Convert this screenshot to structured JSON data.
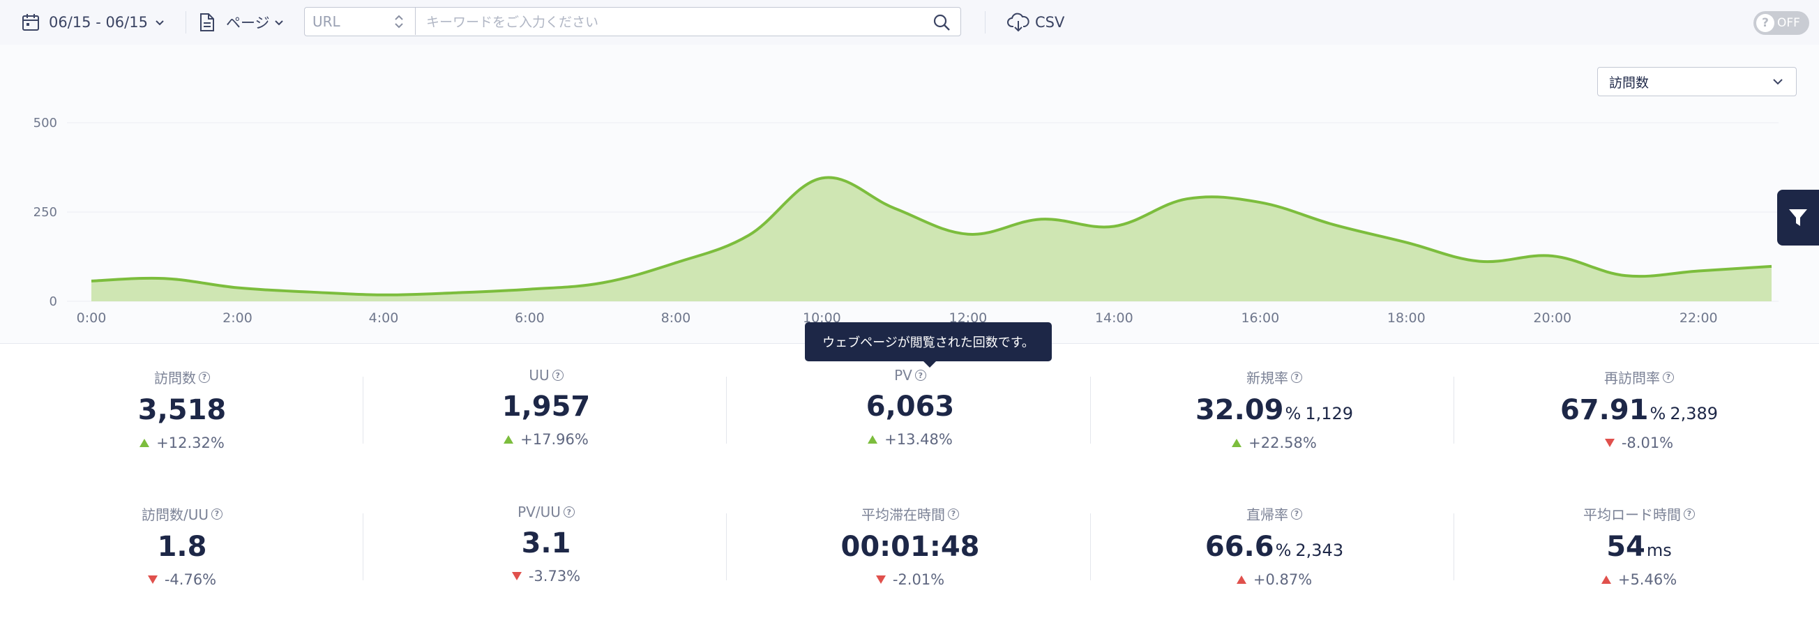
{
  "toolbar": {
    "date_range": "06/15 - 06/15",
    "page_selector": "ページ",
    "url_select": "URL",
    "keyword_placeholder": "キーワードをご入力ください",
    "csv_label": "CSV",
    "toggle_label": "OFF",
    "toggle_state": "off"
  },
  "metric_select": {
    "value": "訪問数"
  },
  "tooltip": {
    "text": "ウェブページが閲覧された回数です。"
  },
  "colors": {
    "line": "#7cbd3d",
    "area_fill": "#cfe6b3",
    "up_indicator": "#7cbd3d",
    "down_indicator": "#e0504c",
    "navy": "#1d2747"
  },
  "chart_data": {
    "type": "area",
    "x": [
      "0:00",
      "1:00",
      "2:00",
      "3:00",
      "4:00",
      "5:00",
      "6:00",
      "7:00",
      "8:00",
      "9:00",
      "10:00",
      "11:00",
      "12:00",
      "13:00",
      "14:00",
      "15:00",
      "16:00",
      "17:00",
      "18:00",
      "19:00",
      "20:00",
      "21:00",
      "22:00",
      "23:00"
    ],
    "x_ticks": [
      "0:00",
      "2:00",
      "4:00",
      "6:00",
      "8:00",
      "10:00",
      "12:00",
      "14:00",
      "16:00",
      "18:00",
      "20:00",
      "22:00"
    ],
    "values": [
      57,
      64,
      38,
      26,
      18,
      24,
      34,
      52,
      108,
      185,
      345,
      260,
      188,
      230,
      210,
      287,
      277,
      215,
      165,
      112,
      127,
      72,
      85,
      98
    ],
    "ylim": [
      0,
      500
    ],
    "y_ticks": [
      "0",
      "250",
      "500"
    ],
    "grid": true
  },
  "kpis": [
    {
      "label": "訪問数",
      "value": "3,518",
      "unit": "",
      "sub": "",
      "direction": "up",
      "color": "green",
      "change": "+12.32%"
    },
    {
      "label": "UU",
      "value": "1,957",
      "unit": "",
      "sub": "",
      "direction": "up",
      "color": "green",
      "change": "+17.96%"
    },
    {
      "label": "PV",
      "value": "6,063",
      "unit": "",
      "sub": "",
      "direction": "up",
      "color": "green",
      "change": "+13.48%"
    },
    {
      "label": "新規率",
      "value": "32.09",
      "unit": "%",
      "sub": "1,129",
      "direction": "up",
      "color": "green",
      "change": "+22.58%"
    },
    {
      "label": "再訪問率",
      "value": "67.91",
      "unit": "%",
      "sub": "2,389",
      "direction": "down",
      "color": "red",
      "change": "-8.01%"
    },
    {
      "label": "訪問数/UU",
      "value": "1.8",
      "unit": "",
      "sub": "",
      "direction": "down",
      "color": "red",
      "change": "-4.76%"
    },
    {
      "label": "PV/UU",
      "value": "3.1",
      "unit": "",
      "sub": "",
      "direction": "down",
      "color": "red",
      "change": "-3.73%"
    },
    {
      "label": "平均滞在時間",
      "value": "00:01:48",
      "unit": "",
      "sub": "",
      "direction": "down",
      "color": "red",
      "change": "-2.01%"
    },
    {
      "label": "直帰率",
      "value": "66.6",
      "unit": "%",
      "sub": "2,343",
      "direction": "up",
      "color": "red",
      "change": "+0.87%"
    },
    {
      "label": "平均ロード時間",
      "value": "54",
      "unit": "ms",
      "sub": "",
      "direction": "up",
      "color": "red",
      "change": "+5.46%"
    }
  ]
}
